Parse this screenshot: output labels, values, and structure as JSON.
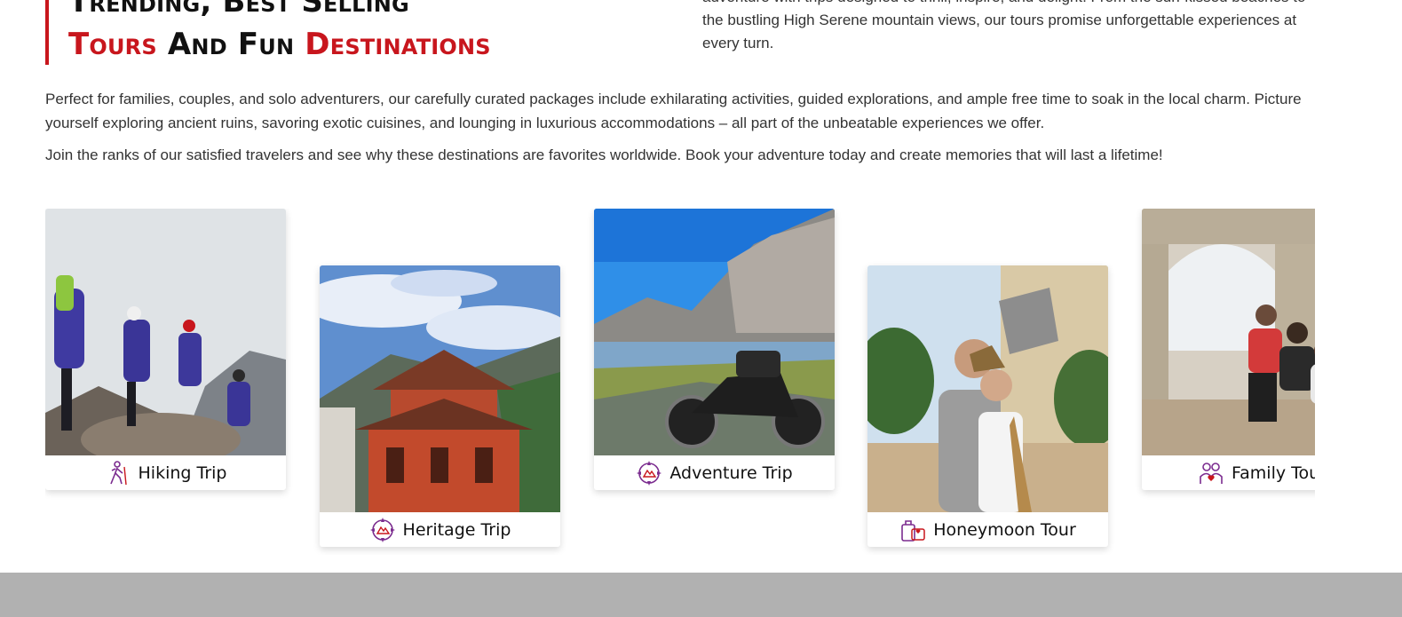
{
  "heading": {
    "line1": "Trending, Best Selling",
    "line2_red1": "Tours",
    "line2_mid": " And Fun ",
    "line2_red2": "Destinations"
  },
  "intro_text": "adventure with trips designed to thrill, inspire, and delight. From the sun-kissed beaches to the bustling High Serene mountain views, our tours promise unforgettable experiences at every turn.",
  "paragraphs": [
    "Perfect for families, couples, and solo adventurers, our carefully curated packages include exhilarating activities, guided explorations, and ample free time to soak in the local charm. Picture yourself exploring ancient ruins, savoring exotic cuisines, and lounging in luxurious accommodations – all part of the unbeatable experiences we offer.",
    "Join the ranks of our satisfied travelers and see why these destinations are favorites worldwide. Book your adventure today and create memories that will last a lifetime!"
  ],
  "cards": [
    {
      "label": "Hiking Trip",
      "icon": "hiker-icon"
    },
    {
      "label": "Heritage Trip",
      "icon": "compass-badge-icon"
    },
    {
      "label": "Adventure Trip",
      "icon": "compass-badge-icon"
    },
    {
      "label": "Honeymoon Tour",
      "icon": "suitcase-icon"
    },
    {
      "label": "Family Tour",
      "icon": "family-icon"
    }
  ],
  "colors": {
    "accent": "#c8161d",
    "icon": "#7b2c8f",
    "footer": "#b1b1b1"
  }
}
